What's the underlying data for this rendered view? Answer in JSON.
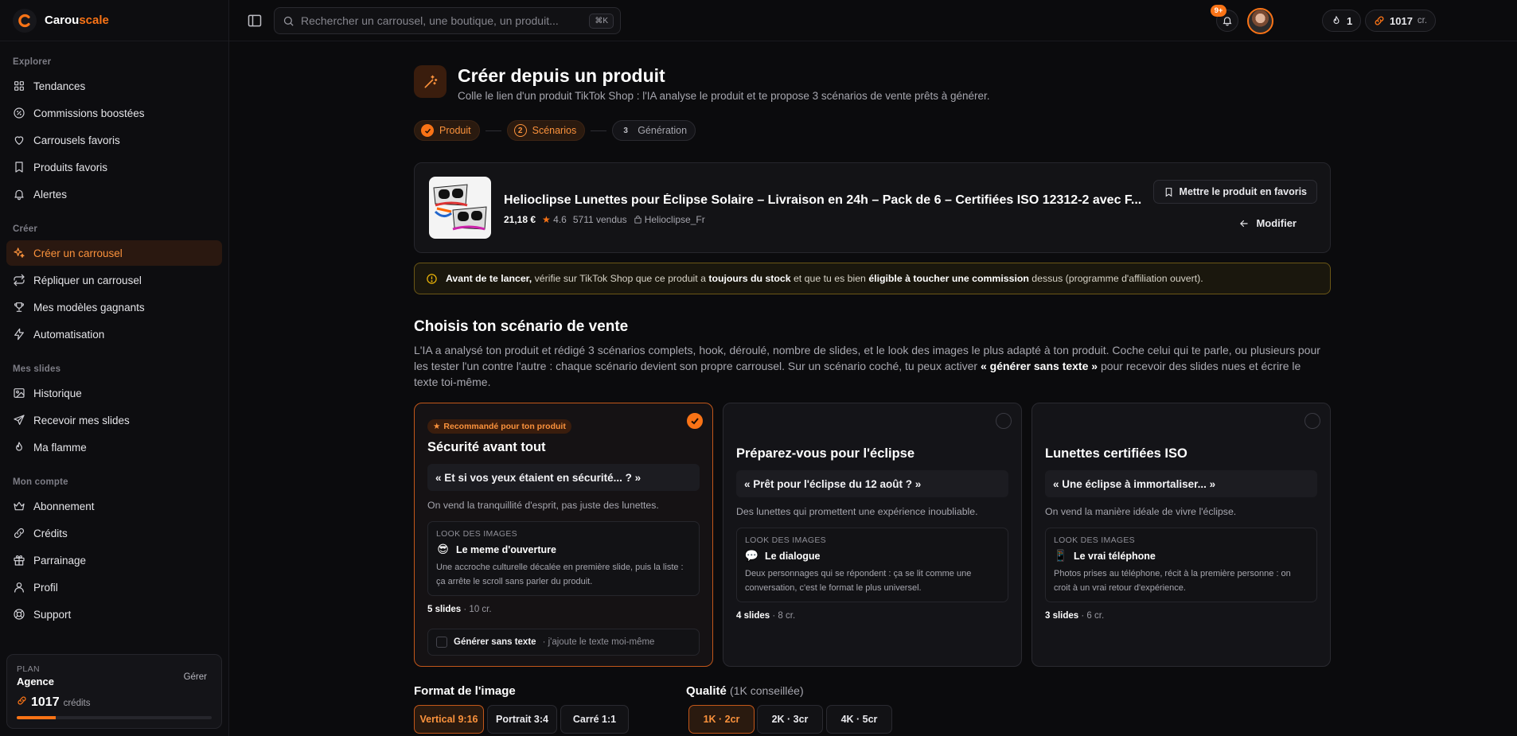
{
  "brand": {
    "name_prefix": "Carou",
    "name_suffix": "scale"
  },
  "sidebar": {
    "sections": [
      {
        "title": "Explorer",
        "items": [
          {
            "label": "Tendances",
            "icon": "grid-icon"
          },
          {
            "label": "Commissions boostées",
            "icon": "percent-icon"
          },
          {
            "label": "Carrousels favoris",
            "icon": "heart-icon"
          },
          {
            "label": "Produits favoris",
            "icon": "bookmark-icon"
          },
          {
            "label": "Alertes",
            "icon": "bell-icon"
          }
        ]
      },
      {
        "title": "Créer",
        "items": [
          {
            "label": "Créer un carrousel",
            "icon": "sparkles-icon",
            "active": true
          },
          {
            "label": "Répliquer un carrousel",
            "icon": "repeat-icon"
          },
          {
            "label": "Mes modèles gagnants",
            "icon": "trophy-icon"
          },
          {
            "label": "Automatisation",
            "icon": "bolt-icon"
          }
        ]
      },
      {
        "title": "Mes slides",
        "items": [
          {
            "label": "Historique",
            "icon": "image-icon"
          },
          {
            "label": "Recevoir mes slides",
            "icon": "send-icon"
          },
          {
            "label": "Ma flamme",
            "icon": "flame-icon"
          }
        ]
      },
      {
        "title": "Mon compte",
        "items": [
          {
            "label": "Abonnement",
            "icon": "crown-icon"
          },
          {
            "label": "Crédits",
            "icon": "coins-icon"
          },
          {
            "label": "Parrainage",
            "icon": "gift-icon"
          },
          {
            "label": "Profil",
            "icon": "user-icon"
          },
          {
            "label": "Support",
            "icon": "lifebuoy-icon"
          }
        ]
      }
    ],
    "plan": {
      "label": "PLAN",
      "name": "Agence",
      "manage": "Gérer",
      "credits": "1017",
      "credits_unit": "crédits",
      "usage_fraction": 0.2
    }
  },
  "topbar": {
    "search_placeholder": "Rechercher un carrousel, une boutique, un produit...",
    "shortcut": "⌘K",
    "streak": "1",
    "credits": "1017",
    "credits_unit": "cr.",
    "notifications_badge": "9+"
  },
  "page": {
    "title": "Créer depuis un produit",
    "subtitle": "Colle le lien d'un produit TikTok Shop : l'IA analyse le produit et te propose 3 scénarios de vente prêts à générer."
  },
  "steps": [
    {
      "label": "Produit",
      "state": "done",
      "marker": ""
    },
    {
      "label": "Scénarios",
      "state": "current",
      "marker": "2"
    },
    {
      "label": "Génération",
      "state": "todo",
      "marker": "3"
    }
  ],
  "product": {
    "title": "Helioclipse Lunettes pour Éclipse Solaire – Livraison en 24h – Pack de 6 – Certifiées ISO 12312-2 avec F...",
    "price": "21,18 €",
    "rating": "4.6",
    "sold": "5711 vendus",
    "shop": "Helioclipse_Fr",
    "fav_button": "Mettre le produit en favoris",
    "edit_button": "Modifier"
  },
  "alert": {
    "lead": "Avant de te lancer,",
    "t1": " vérifie sur TikTok Shop que ce produit a ",
    "b1": "toujours du stock",
    "t2": " et que tu es bien ",
    "b2": "éligible à toucher une commission",
    "t3": " dessus (programme d'affiliation ouvert)."
  },
  "scenarios_section": {
    "title": "Choisis ton scénario de vente",
    "desc_1": "L'IA a analysé ton produit et rédigé 3 scénarios complets, hook, déroulé, nombre de slides, et le look des images le plus adapté à ton produit. Coche celui qui te parle, ou plusieurs pour les tester l'un contre l'autre : chaque scénario devient son propre carrousel. Sur un scénario coché, tu peux activer ",
    "desc_bold": "« générer sans texte »",
    "desc_2": " pour recevoir des slides nues et écrire le texte toi-même."
  },
  "scenarios": [
    {
      "selected": true,
      "badge": "Recommandé pour ton produit",
      "title": "Sécurité avant tout",
      "hook": "« Et si vos yeux étaient en sécurité... ? »",
      "desc": "On vend la tranquillité d'esprit, pas juste des lunettes.",
      "look_label": "LOOK DES IMAGES",
      "look_emoji": "😎",
      "look_name": "Le meme d'ouverture",
      "look_text": "Une accroche culturelle décalée en première slide, puis la liste : ça arrête le scroll sans parler du produit.",
      "slides": "5 slides",
      "cost": " · 10 cr.",
      "no_text_label": "Générer sans texte",
      "no_text_hint": " · j'ajoute le texte moi-même"
    },
    {
      "selected": false,
      "title": "Préparez-vous pour l'éclipse",
      "hook": "« Prêt pour l'éclipse du 12 août ? »",
      "desc": "Des lunettes qui promettent une expérience inoubliable.",
      "look_label": "LOOK DES IMAGES",
      "look_emoji": "💬",
      "look_name": "Le dialogue",
      "look_text": "Deux personnages qui se répondent : ça se lit comme une conversation, c'est le format le plus universel.",
      "slides": "4 slides",
      "cost": " · 8 cr."
    },
    {
      "selected": false,
      "title": "Lunettes certifiées ISO",
      "hook": "« Une éclipse à immortaliser... »",
      "desc": "On vend la manière idéale de vivre l'éclipse.",
      "look_label": "LOOK DES IMAGES",
      "look_emoji": "📱",
      "look_name": "Le vrai téléphone",
      "look_text": "Photos prises au téléphone, récit à la première personne : on croit à un vrai retour d'expérience.",
      "slides": "3 slides",
      "cost": " · 6 cr."
    }
  ],
  "format": {
    "label": "Format de l'image",
    "options": [
      "Vertical 9:16",
      "Portrait 3:4",
      "Carré 1:1"
    ],
    "selected": 0
  },
  "quality": {
    "label": "Qualité",
    "hint": "(1K conseillée)",
    "options": [
      "1K · 2cr",
      "2K · 3cr",
      "4K · 5cr"
    ],
    "selected": 0
  },
  "colors": {
    "accent": "#f97316",
    "warning": "#eab308"
  }
}
